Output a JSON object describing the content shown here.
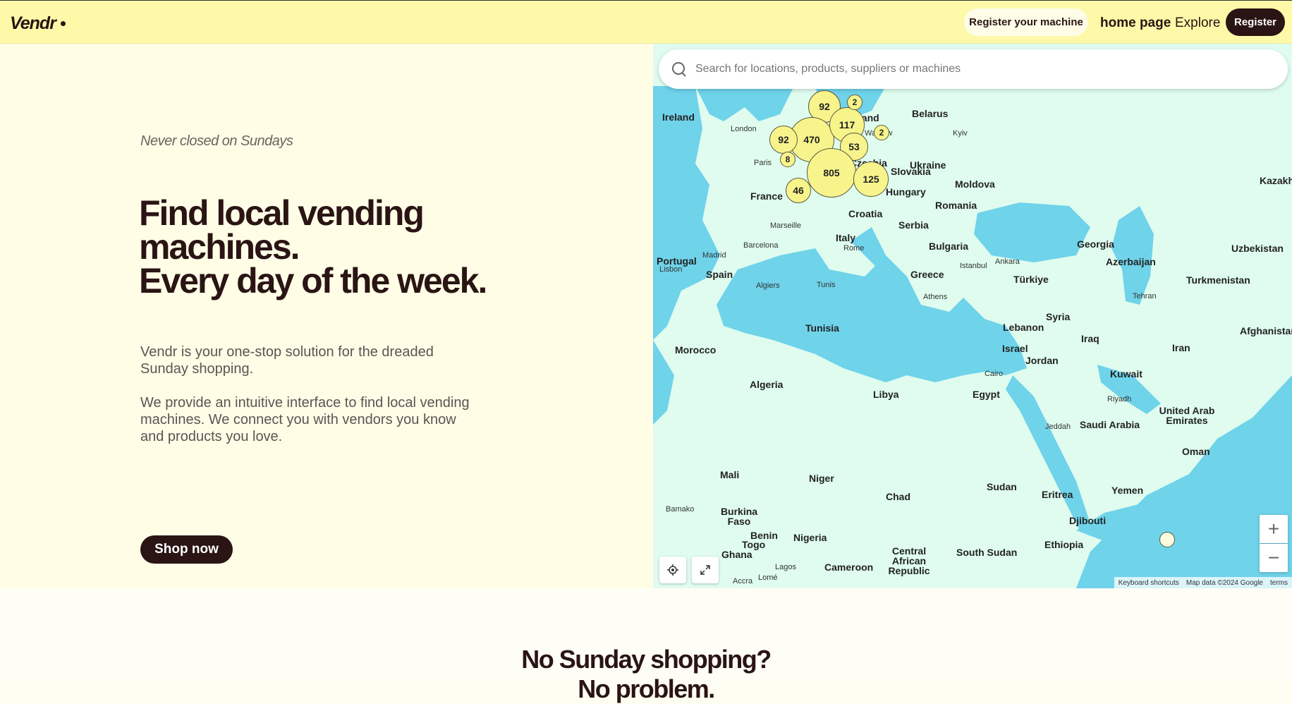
{
  "header": {
    "logo": "Vendr",
    "register_machine": "Register your machine",
    "home": "home page",
    "explore": "Explore",
    "register": "Register"
  },
  "hero": {
    "tagline": "Never closed on Sundays",
    "headline_line1": "Find local vending",
    "headline_line2": "machines.",
    "headline_line3": "Every day of the week.",
    "para1": "Vendr is your one-stop solution for the dreaded Sunday shopping.",
    "para2": "We provide an intuitive interface to find local vending machines. We connect you with vendors you know and products you love.",
    "cta": "Shop now"
  },
  "map": {
    "search_placeholder": "Search for locations, products, suppliers or machines",
    "clusters": [
      "92",
      "470",
      "117",
      "53",
      "805",
      "125",
      "46",
      "92",
      "8",
      "2",
      "2"
    ],
    "countries": [
      "Ireland",
      "Poland",
      "Belarus",
      "Ukraine",
      "Slovakia",
      "Hungary",
      "Moldova",
      "Romania",
      "France",
      "Croatia",
      "Serbia",
      "Italy",
      "Bulgaria",
      "Georgia",
      "Azerbaijan",
      "Uzbekistan",
      "Turkmenistan",
      "Portugal",
      "Spain",
      "Greece",
      "Türkiye",
      "Tunisia",
      "Syria",
      "Lebanon",
      "Iraq",
      "Iran",
      "Afghanistan",
      "Israel",
      "Jordan",
      "Morocco",
      "Kuwait",
      "Algeria",
      "Libya",
      "Egypt",
      "Saudi Arabia",
      "United Arab Emirates",
      "Oman",
      "Mali",
      "Niger",
      "Chad",
      "Sudan",
      "Eritrea",
      "Yemen",
      "Djibouti",
      "Ethiopia",
      "Burkina Faso",
      "Benin",
      "Nigeria",
      "Togo",
      "Ghana",
      "Cameroon",
      "Central African Republic",
      "South Sudan",
      "Kazakh",
      "Czechia"
    ],
    "cities": [
      "London",
      "Paris",
      "Warsaw",
      "Kyiv",
      "Marseille",
      "Barcelona",
      "Madrid",
      "Lisbon",
      "Rome",
      "Istanbul",
      "Ankara",
      "Algiers",
      "Tunis",
      "Athens",
      "Tehran",
      "Cairo",
      "Riyadh",
      "Jeddah",
      "Bamako",
      "Lagos",
      "Accra",
      "Lomé"
    ],
    "zoom_in": "+",
    "zoom_out": "−",
    "attribution_shortcuts": "Keyboard shortcuts",
    "attribution_data": "Map data ©2024 Google",
    "attribution_terms": "terms"
  },
  "section2": {
    "title": "No Sunday shopping?",
    "subtitle": "No problem."
  },
  "colors": {
    "header_bg": "#fdf9a8",
    "hero_bg": "#fffde6",
    "accent_dark": "#2a1414",
    "water": "#6fd3ea",
    "land": "#dffcef",
    "cluster": "#f8f48c"
  }
}
